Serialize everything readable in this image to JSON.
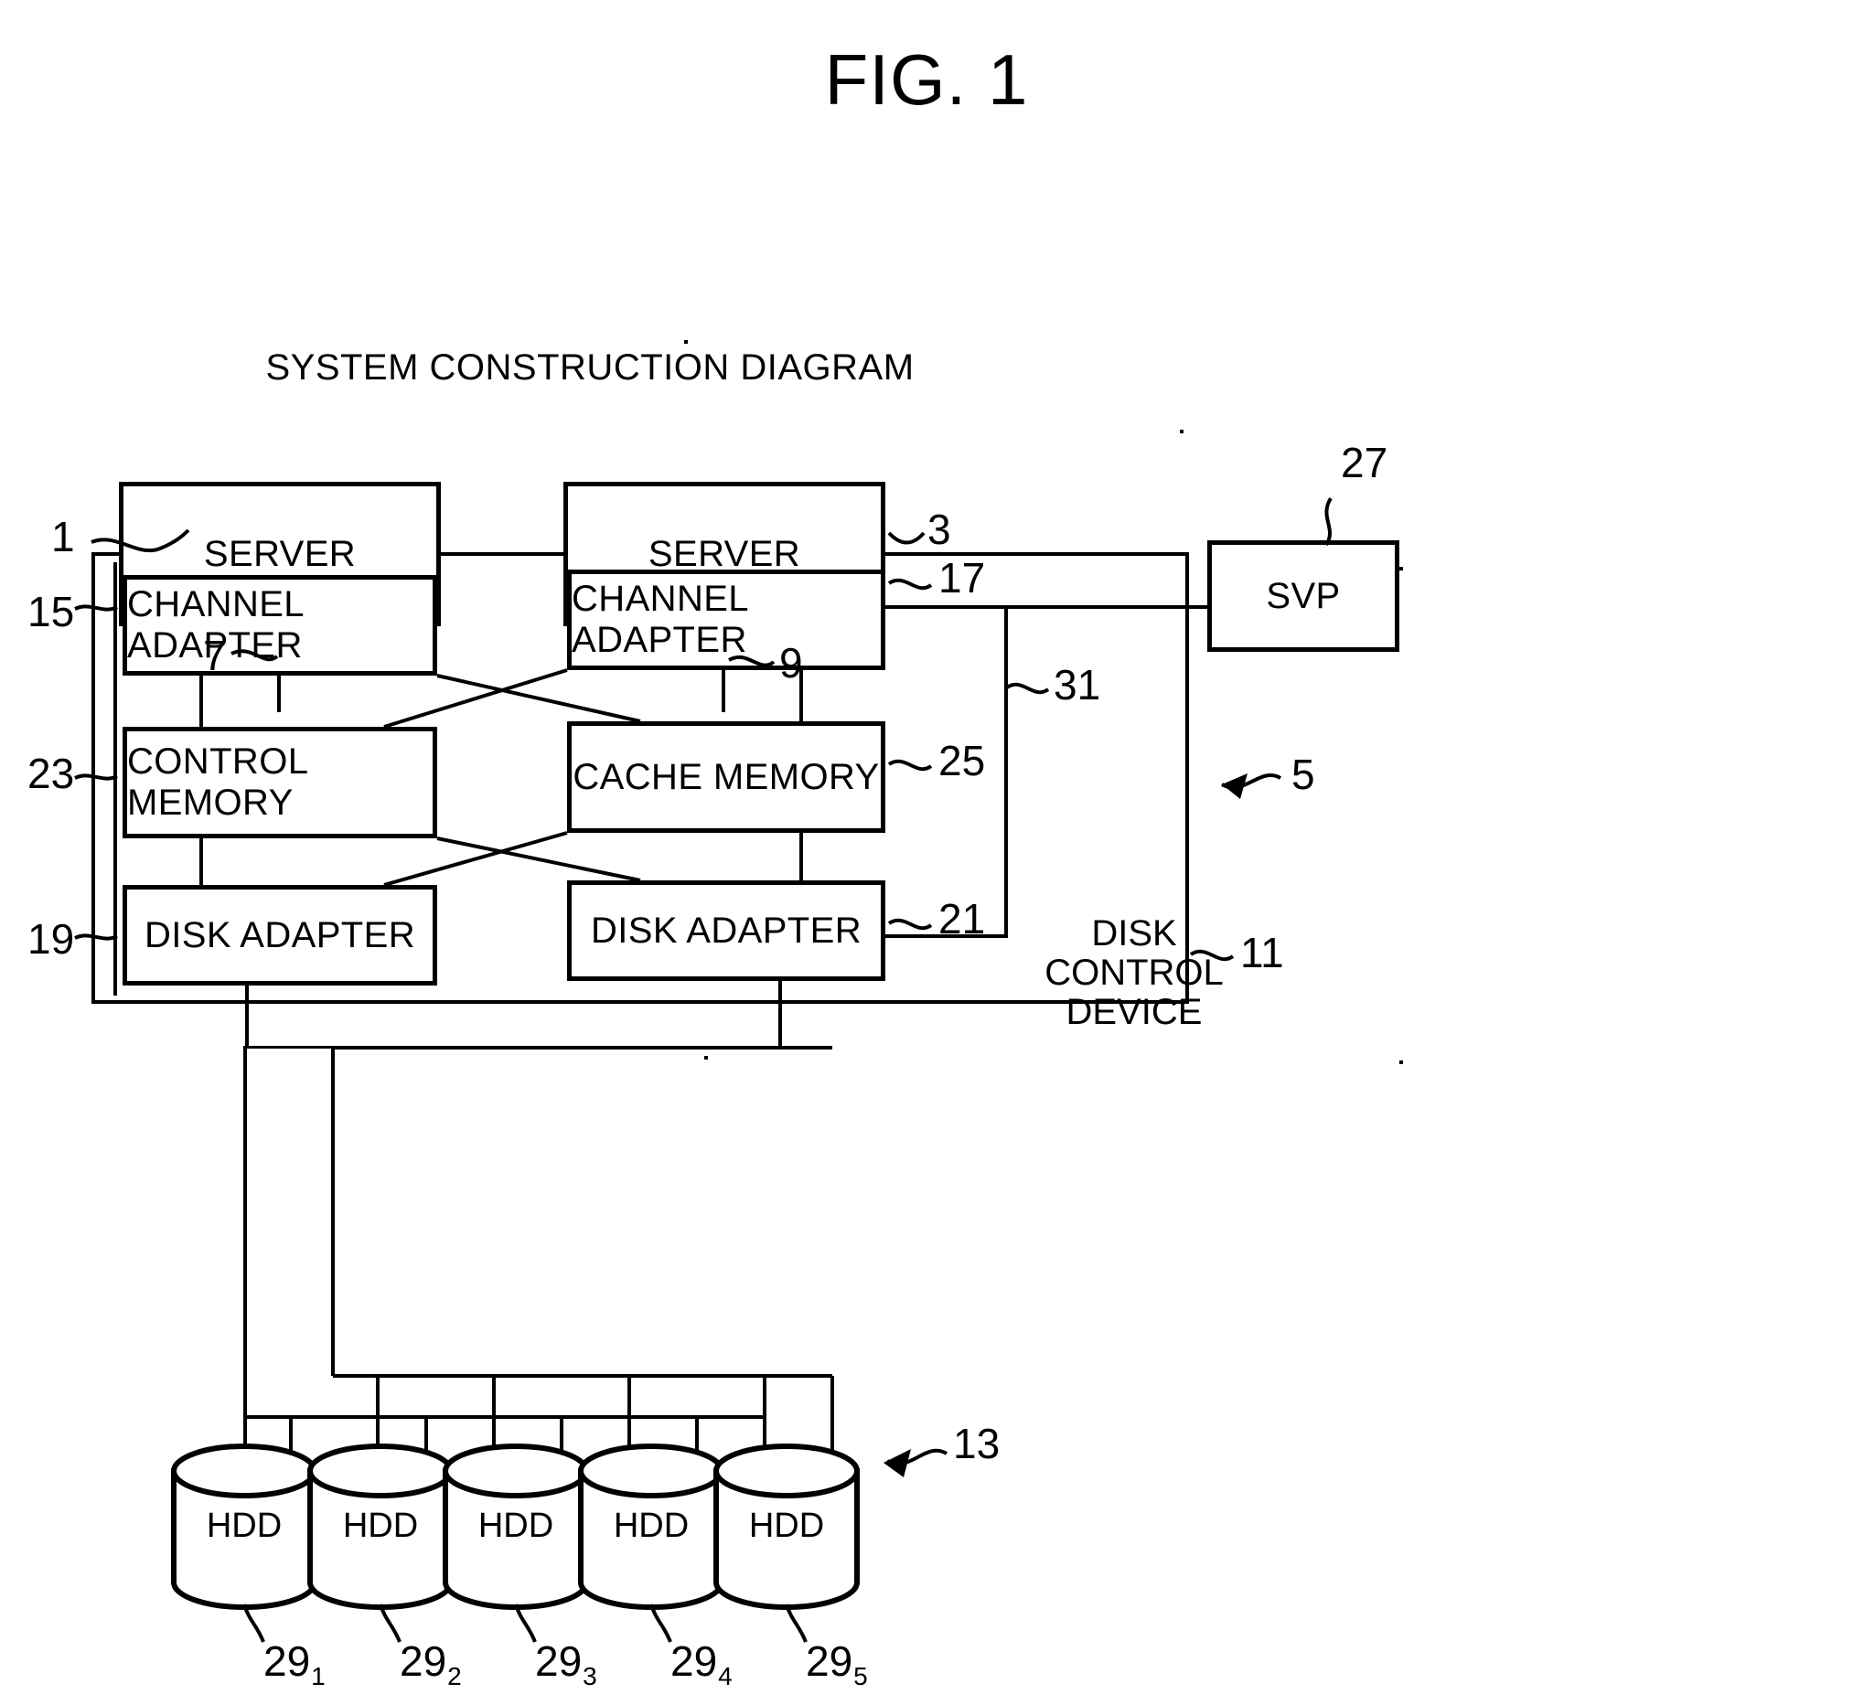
{
  "figure": {
    "title": "FIG. 1",
    "subtitle": "SYSTEM CONSTRUCTION DIAGRAM"
  },
  "blocks": {
    "server_left": {
      "label": "SERVER",
      "ref": "1"
    },
    "server_right": {
      "label": "SERVER",
      "ref": "3"
    },
    "svp": {
      "label": "SVP",
      "ref": "27"
    },
    "channel_adapter_left": {
      "label": "CHANNEL ADAPTER",
      "ref": "15"
    },
    "channel_adapter_right": {
      "label": "CHANNEL ADAPTER",
      "ref": "17"
    },
    "control_memory": {
      "label": "CONTROL MEMORY",
      "ref": "23"
    },
    "cache_memory": {
      "label": "CACHE MEMORY",
      "ref": "25"
    },
    "disk_adapter_left": {
      "label": "DISK ADAPTER",
      "ref": "19"
    },
    "disk_adapter_right": {
      "label": "DISK ADAPTER",
      "ref": "21"
    },
    "disk_control_device": {
      "label": "DISK CONTROL DEVICE",
      "ref": "11"
    }
  },
  "connections": {
    "server_left_link_ref": "7",
    "server_right_link_ref": "9",
    "internal_bus_ref": "31",
    "system_ref": "5",
    "disk_array_ref": "13"
  },
  "disks": [
    {
      "label": "HDD",
      "ref": "29",
      "sub": "1"
    },
    {
      "label": "HDD",
      "ref": "29",
      "sub": "2"
    },
    {
      "label": "HDD",
      "ref": "29",
      "sub": "3"
    },
    {
      "label": "HDD",
      "ref": "29",
      "sub": "4"
    },
    {
      "label": "HDD",
      "ref": "29",
      "sub": "5"
    }
  ],
  "colors": {
    "ink": "#000000",
    "paper": "#ffffff"
  }
}
